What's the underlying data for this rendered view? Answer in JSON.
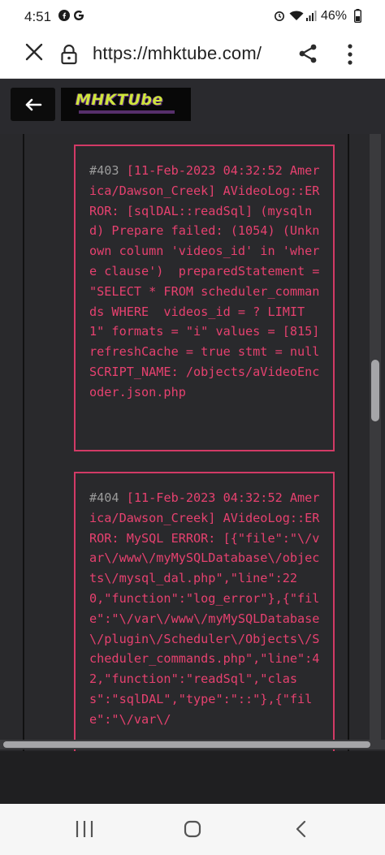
{
  "status_bar": {
    "time": "4:51",
    "battery": "46%",
    "icons": [
      "facebook-icon",
      "google-icon",
      "alarm-icon",
      "wifi-icon",
      "signal-icon",
      "battery-icon"
    ]
  },
  "browser": {
    "url": "https://mhktube.com/",
    "close_icon": "close-icon",
    "lock_icon": "lock-icon",
    "share_icon": "share-icon",
    "menu_icon": "more-vert-icon"
  },
  "header": {
    "back_icon": "arrow-left-icon",
    "logo_text": "MHKTUbe"
  },
  "log_entries": [
    {
      "number": "#403",
      "text": " [11-Feb-2023 04:32:52 America/Dawson_Creek] AVideoLog::ERROR: [sqlDAL::readSql] (mysqlnd) Prepare failed: (1054) (Unknown column 'videos_id' in 'where clause')  preparedStatement = \"SELECT * FROM scheduler_commands WHERE  videos_id = ? LIMIT 1\" formats = \"i\" values = [815] refreshCache = true stmt = null SCRIPT_NAME: /objects/aVideoEncoder.json.php"
    },
    {
      "number": "#404",
      "text": " [11-Feb-2023 04:32:52 America/Dawson_Creek] AVideoLog::ERROR: MySQL ERROR: [{\"file\":\"\\/var\\/www\\/myMySQLDatabase\\/objects\\/mysql_dal.php\",\"line\":220,\"function\":\"log_error\"},{\"file\":\"\\/var\\/www\\/myMySQLDatabase\\/plugin\\/Scheduler\\/Objects\\/Scheduler_commands.php\",\"line\":42,\"function\":\"readSql\",\"class\":\"sqlDAL\",\"type\":\"::\"},{\"file\":\"\\/var\\/"
    }
  ],
  "colors": {
    "log_text": "#e6416f",
    "log_border": "#d23a66",
    "entry_number": "#9b9b9b",
    "page_bg": "#29292c",
    "logo_text": "#cfe63a"
  },
  "nav_bar": {
    "recent_icon": "recent-apps-icon",
    "home_icon": "home-icon",
    "back_icon": "back-chevron-icon"
  }
}
